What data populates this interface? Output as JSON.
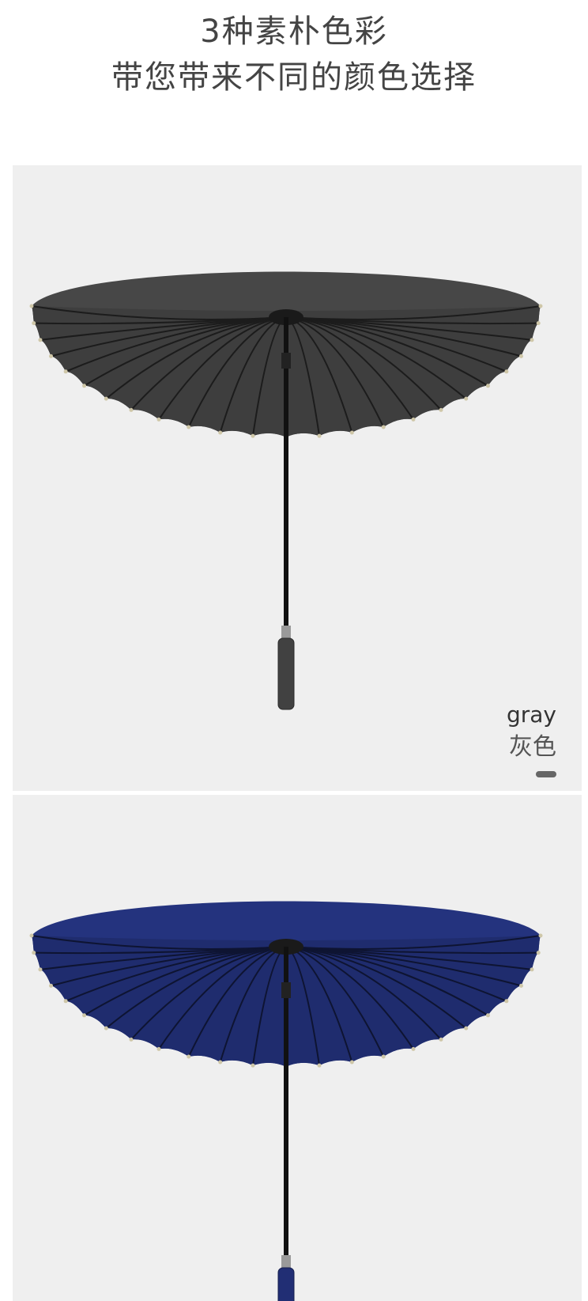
{
  "header": {
    "line1": "3种素朴色彩",
    "line2": "带您带来不同的颜色选择"
  },
  "variants": [
    {
      "label_en": "gray",
      "label_cn": "灰色",
      "canopy_color": "#3e3e3e",
      "swatch_color": "#666666"
    },
    {
      "canopy_color": "#1f2c6e"
    }
  ]
}
